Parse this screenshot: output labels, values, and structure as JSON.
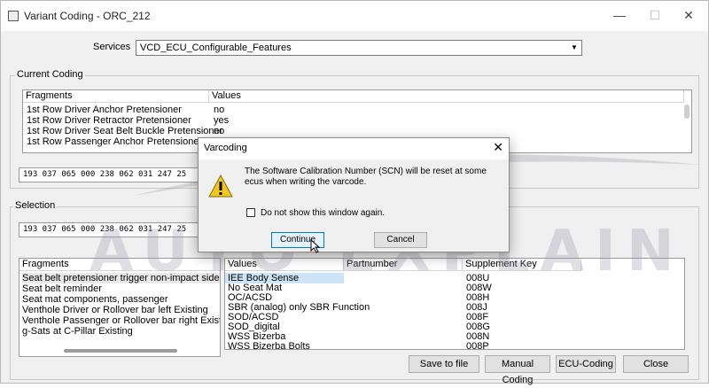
{
  "window": {
    "title": "Variant Coding - ORC_212",
    "minimize_glyph": "—",
    "maximize_glyph": "☐",
    "close_glyph": "✕"
  },
  "services": {
    "label": "Services",
    "selected": "VCD_ECU_Configurable_Features"
  },
  "current_coding": {
    "group_label": "Current Coding",
    "columns": [
      "Fragments",
      "Values"
    ],
    "rows": [
      {
        "fragment": "1st Row Driver Anchor Pretensioner",
        "value": "no"
      },
      {
        "fragment": "1st Row Driver Retractor Pretensioner",
        "value": "yes"
      },
      {
        "fragment": "1st Row Driver Seat Belt Buckle Pretensioner",
        "value": "no"
      },
      {
        "fragment": "1st Row Passenger Anchor Pretensioner",
        "value": "no"
      }
    ],
    "hex": "193 037 065 000 238 062 031 247 25"
  },
  "selection": {
    "group_label": "Selection",
    "hex": "193 037 065 000 238 062 031 247 25",
    "fragments_header": "Fragments",
    "fragments": [
      "Seat belt pretensioner trigger non-impact side for a s",
      "Seat belt reminder",
      "Seat mat components, passenger",
      "Venthole Driver or Rollover bar left Existing",
      "Venthole Passenger or Rollover bar right Existing",
      "g-Sats at C-Pillar Existing"
    ],
    "value_columns": [
      "Values",
      "Partnumber",
      "Supplement Key"
    ],
    "values": [
      {
        "value": "IEE Body Sense",
        "key": "008U"
      },
      {
        "value": "No Seat Mat",
        "key": "008W"
      },
      {
        "value": "OC/ACSD",
        "key": "008H"
      },
      {
        "value": "SBR (analog) only SBR Function",
        "key": "008J"
      },
      {
        "value": "SOD/ACSD",
        "key": "008F"
      },
      {
        "value": "SOD_digital",
        "key": "008G"
      },
      {
        "value": "WSS Bizerba",
        "key": "008N"
      },
      {
        "value": "WSS Bizerba Bolts",
        "key": "008P"
      }
    ]
  },
  "buttons": {
    "save": "Save to file",
    "manual": "Manual Coding",
    "ecu": "ECU-Coding",
    "close": "Close"
  },
  "dialog": {
    "title": "Varcoding",
    "close_glyph": "✕",
    "message": "The Software Calibration Number (SCN) will be reset at some ecus when writing the varcode.",
    "checkbox_label": "Do not show this window again.",
    "continue_label": "Continue",
    "cancel_label": "Cancel"
  },
  "watermark": "AUTO EXPLAIN",
  "colors": {
    "selected_row": "#cce4f7",
    "warning": "#f3c623"
  }
}
